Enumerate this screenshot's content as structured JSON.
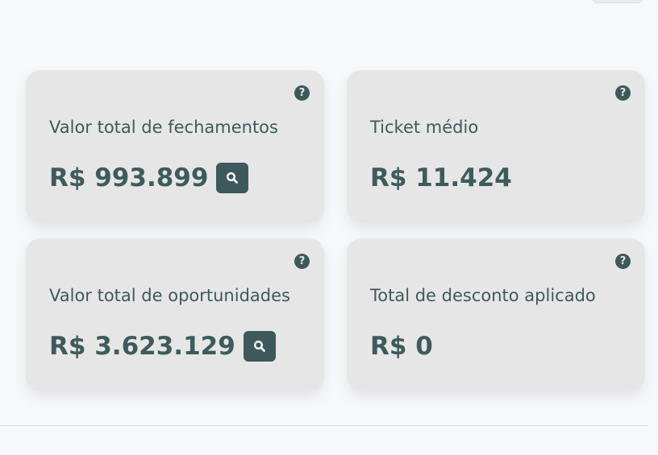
{
  "cards": [
    {
      "title": "Valor total de fechamentos",
      "value": "R$ 993.899",
      "help_glyph": "?",
      "icon": "search-icon"
    },
    {
      "title": "Ticket médio",
      "value": "R$ 11.424",
      "help_glyph": "?"
    },
    {
      "title": "Valor total de oportunidades",
      "value": "R$ 3.623.129",
      "help_glyph": "?",
      "icon": "search-icon"
    },
    {
      "title": "Total de desconto aplicado",
      "value": "R$ 0",
      "help_glyph": "?"
    }
  ],
  "colors": {
    "accent": "#3d595b",
    "card_bg": "#e6e6e6",
    "page_bg": "#f6f8fb"
  }
}
